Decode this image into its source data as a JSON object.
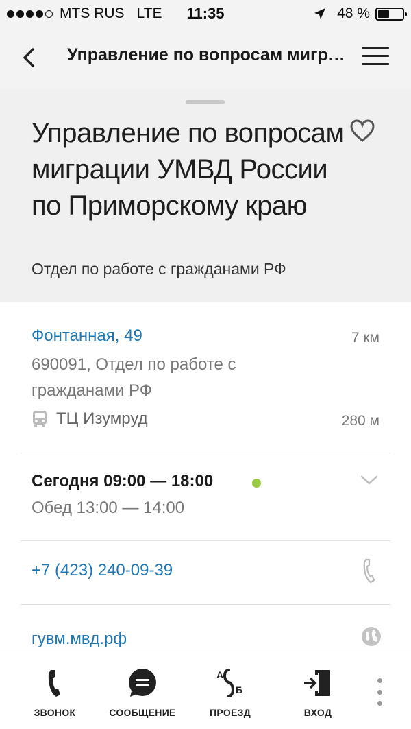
{
  "status_bar": {
    "carrier": "MTS RUS",
    "network": "LTE",
    "time": "11:35",
    "battery": "48 %",
    "battery_level": 0.48
  },
  "nav": {
    "title": "Управление по вопросам миграции УМВД России по Приморскому краю"
  },
  "header": {
    "title": "Управление по вопросам миграции УМВД России по Приморскому краю",
    "subtitle": "Отдел по работе с гражданами РФ"
  },
  "address": {
    "street": "Фонтанная, 49",
    "distance": "7 км",
    "detail": "690091, Отдел по работе с гражданами РФ",
    "transit_stop": "ТЦ Изумруд",
    "transit_distance": "280 м"
  },
  "hours": {
    "today": "Сегодня 09:00 — 18:00",
    "lunch": "Обед 13:00 — 14:00",
    "status_color": "#9ac93f"
  },
  "contacts": {
    "phone": "+7 (423) 240-09-39",
    "website": "гувм.мвд.рф"
  },
  "toolbar": {
    "call_label": "ЗВОНОК",
    "message_label": "СООБЩЕНИЕ",
    "route_label": "ПРОЕЗД",
    "entrance_label": "ВХОД"
  },
  "colors": {
    "link": "#1f78b4",
    "header_bg": "#f0f0f0",
    "open_indicator": "#9ac93f"
  }
}
